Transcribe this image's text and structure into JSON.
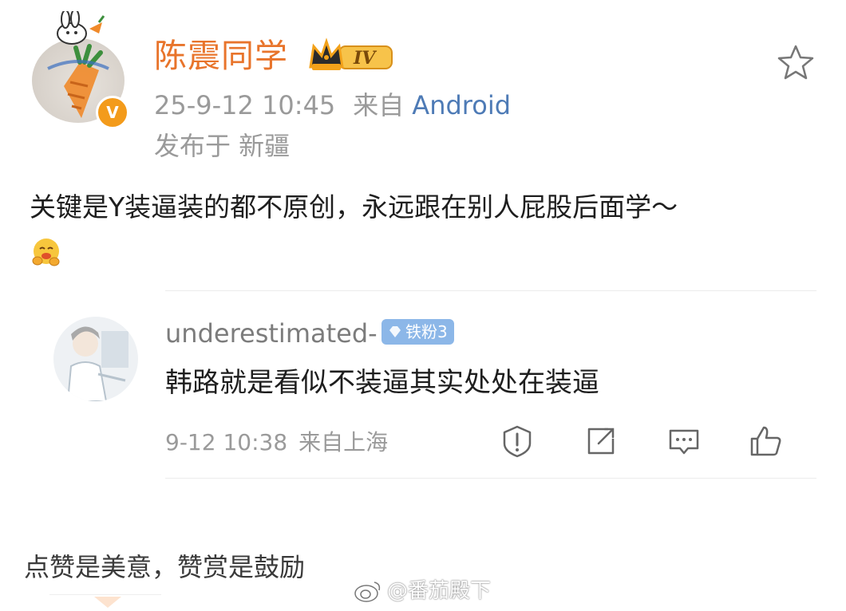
{
  "post": {
    "author": "陈震同学",
    "level_badge": "IV",
    "verified_mark": "V",
    "timestamp": "25-9-12 10:45",
    "from_label": "来自",
    "device": "Android",
    "location": "发布于 新疆",
    "text": "关键是Y装逼装的都不原创，永远跟在别人屁股后面学～",
    "emoji_icon": "hugging-face-icon"
  },
  "comment": {
    "user": "underestimated-",
    "fan_badge": "铁粉3",
    "text": "韩路就是看似不装逼其实处处在装逼",
    "time": "9-12 10:38",
    "location": "来自上海",
    "actions": [
      "report-icon",
      "share-icon",
      "reply-icon",
      "like-icon"
    ]
  },
  "footer": {
    "tagline": "点赞是美意，赞赏是鼓励",
    "watermark": "@番茄殿下"
  },
  "colors": {
    "username": "#e8742b",
    "link": "#4e7bb6",
    "muted": "#9a9a9a",
    "badge_gold": "#f3a21a",
    "fan_badge": "#8cb7e8"
  }
}
